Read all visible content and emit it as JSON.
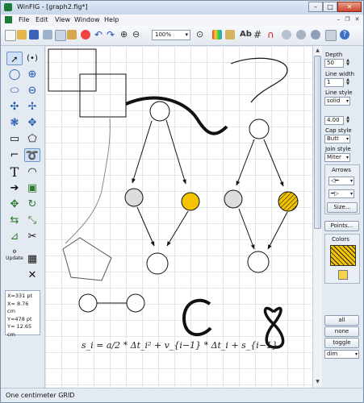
{
  "window": {
    "title": "WinFIG - [graph2.fig*]",
    "min": "–",
    "max": "□",
    "close": "✕"
  },
  "menu": [
    "File",
    "Edit",
    "View",
    "Window",
    "Help"
  ],
  "toolbar": {
    "zoom": "100%"
  },
  "coords": {
    "x_pt": "X=331 pt",
    "x_cm": "X= 8.76 cm",
    "y_pt": "Y=478 pt",
    "y_cm": "Y= 12.65 cm"
  },
  "tools": {
    "update_label": "Update"
  },
  "properties": {
    "depth_label": "Depth",
    "depth": "50",
    "line_width_label": "Line width",
    "line_width": "1",
    "line_style_label": "Line style",
    "line_style": "solid",
    "style_value": "4.00",
    "cap_style_label": "Cap style",
    "cap_style": "Butt",
    "join_style_label": "Join style",
    "join_style": "Miter",
    "arrows_label": "Arrows",
    "size_button": "Size...",
    "points_button": "Points...",
    "colors_label": "Colors",
    "fill_color": "#f4c400"
  },
  "selection": {
    "all": "all",
    "none": "none",
    "toggle": "toggle",
    "mode": "dim"
  },
  "canvas": {
    "formula": "s_i = a/2 * Δt_i² + v_{i−1} * Δt_i + s_{i−1}"
  },
  "status": {
    "grid": "One centimeter GRID"
  }
}
